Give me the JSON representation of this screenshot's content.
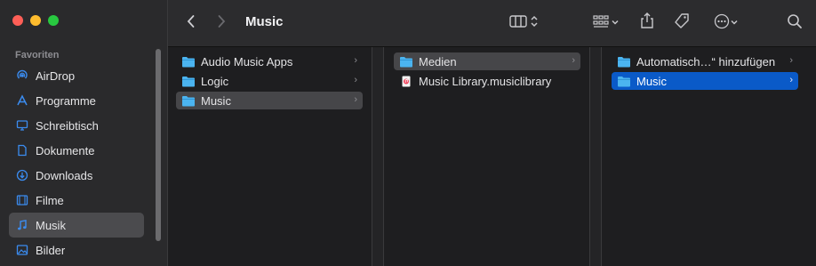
{
  "sidebar": {
    "section_label": "Favoriten",
    "items": [
      {
        "label": "AirDrop",
        "icon": "airdrop-icon"
      },
      {
        "label": "Programme",
        "icon": "applications-icon"
      },
      {
        "label": "Schreibtisch",
        "icon": "desktop-icon"
      },
      {
        "label": "Dokumente",
        "icon": "document-icon"
      },
      {
        "label": "Downloads",
        "icon": "download-icon"
      },
      {
        "label": "Filme",
        "icon": "film-icon"
      },
      {
        "label": "Musik",
        "icon": "music-note-icon",
        "active": true
      },
      {
        "label": "Bilder",
        "icon": "photo-icon"
      }
    ]
  },
  "toolbar": {
    "title": "Music"
  },
  "columns": [
    {
      "items": [
        {
          "label": "Audio Music Apps",
          "type": "folder",
          "has_children": true
        },
        {
          "label": "Logic",
          "type": "folder",
          "has_children": true
        },
        {
          "label": "Music",
          "type": "folder",
          "has_children": true,
          "selected": "gray"
        }
      ]
    },
    {
      "items": [
        {
          "label": "Medien",
          "type": "folder",
          "has_children": true,
          "selected": "gray"
        },
        {
          "label": "Music Library.musiclibrary",
          "type": "file",
          "has_children": false
        }
      ]
    },
    {
      "items": [
        {
          "label": "Automatisch…“ hinzufügen",
          "type": "folder",
          "has_children": true
        },
        {
          "label": "Music",
          "type": "folder",
          "has_children": true,
          "selected": "blue"
        }
      ]
    }
  ],
  "colors": {
    "accent": "#0a5ac8",
    "folder": "#4bb4f0",
    "sidebar_icon": "#3b8cf0"
  }
}
